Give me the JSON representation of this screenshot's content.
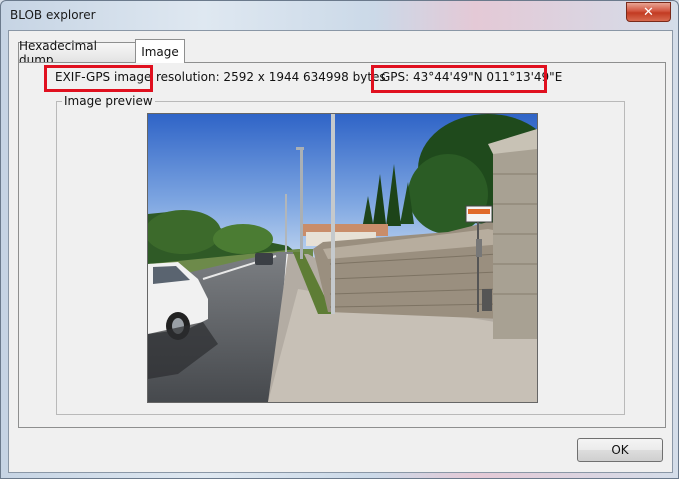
{
  "window": {
    "title": "BLOB explorer",
    "close_label": "✕"
  },
  "tabs": [
    {
      "label": "Hexadecimal dump",
      "active": false
    },
    {
      "label": "Image",
      "active": true
    }
  ],
  "info": {
    "type": "EXIF-GPS image",
    "resolution": "resolution: 2592 x 1944",
    "size": "634998 bytes",
    "gps": "GPS: 43°44'49\"N 011°13'49\"E"
  },
  "preview": {
    "label": "Image preview"
  },
  "buttons": {
    "ok": "OK"
  },
  "colors": {
    "highlight": "#e0101f",
    "close_button": "#c23a22"
  }
}
